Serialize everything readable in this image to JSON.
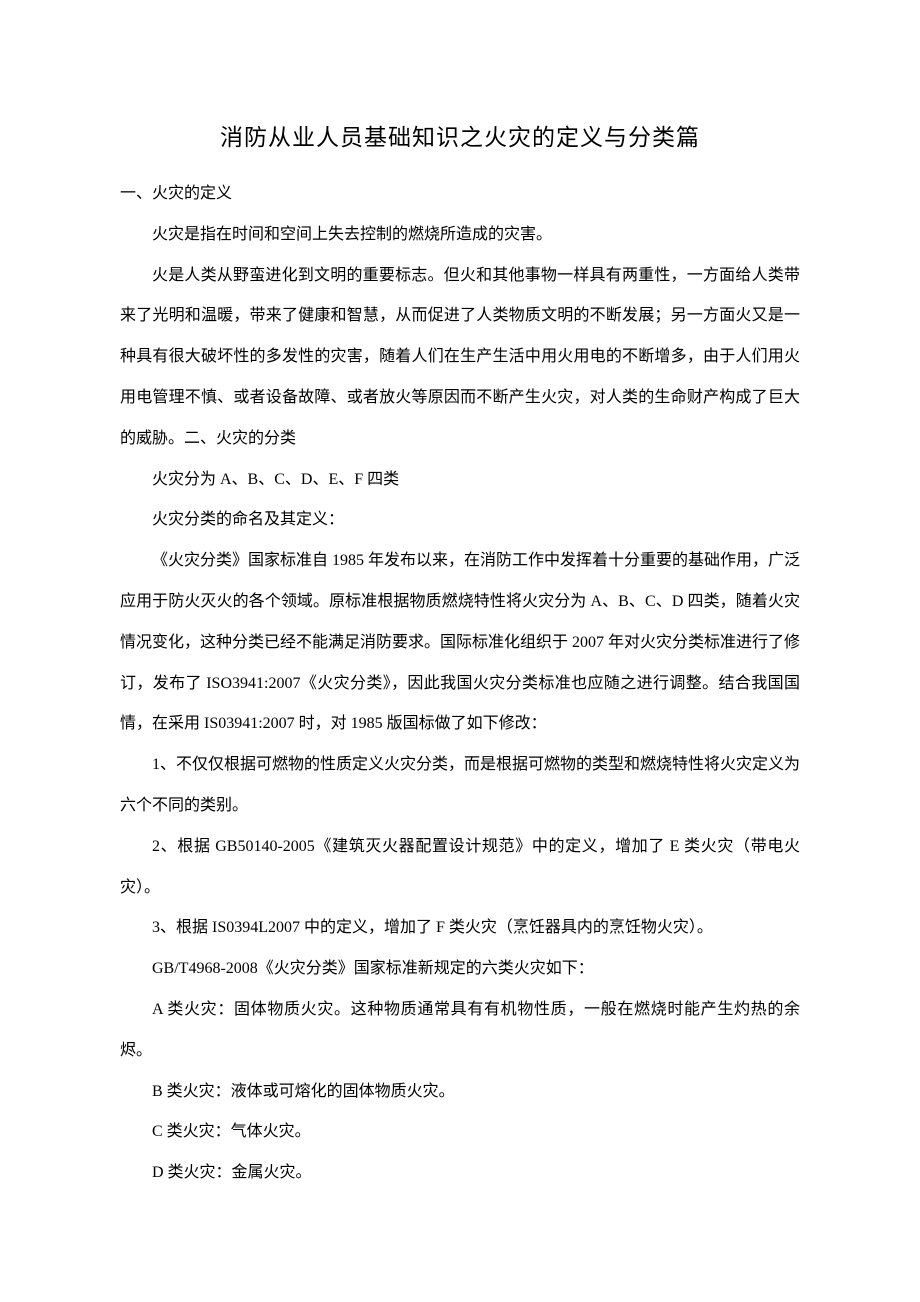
{
  "title": "消防从业人员基础知识之火灾的定义与分类篇",
  "s1_head": "一、火灾的定义",
  "p1": "火灾是指在时间和空间上失去控制的燃烧所造成的灾害。",
  "p2": "火是人类从野蛮进化到文明的重要标志。但火和其他事物一样具有两重性，一方面给人类带来了光明和温暖，带来了健康和智慧，从而促进了人类物质文明的不断发展；另一方面火又是一种具有很大破坏性的多发性的灾害，随着人们在生产生活中用火用电的不断增多，由于人们用火用电管理不慎、或者设备故障、或者放火等原因而不断产生火灾，对人类的生命财产构成了巨大的威胁。二、火灾的分类",
  "p3": "火灾分为 A、B、C、D、E、F 四类",
  "p4": "火灾分类的命名及其定义：",
  "p5": "《火灾分类》国家标准自 1985 年发布以来，在消防工作中发挥着十分重要的基础作用，广泛应用于防火灭火的各个领域。原标准根据物质燃烧特性将火灾分为 A、B、C、D 四类，随着火灾情况变化，这种分类已经不能满足消防要求。国际标准化组织于 2007 年对火灾分类标准进行了修订，发布了 ISO3941:2007《火灾分类》，因此我国火灾分类标准也应随之进行调整。结合我国国情，在采用 IS03941:2007 时，对 1985 版国标做了如下修改：",
  "p6": "1、不仅仅根据可燃物的性质定义火灾分类，而是根据可燃物的类型和燃烧特性将火灾定义为六个不同的类别。",
  "p7": "2、根据 GB50140-2005《建筑灭火器配置设计规范》中的定义，增加了 E 类火灾（带电火灾）。",
  "p8": "3、根据 IS0394L2007 中的定义，增加了 F 类火灾（烹饪器具内的烹饪物火灾）。",
  "p9": "GB/T4968-2008《火灾分类》国家标准新规定的六类火灾如下：",
  "p10": "A 类火灾：固体物质火灾。这种物质通常具有有机物性质，一般在燃烧时能产生灼热的余烬。",
  "p11": "B 类火灾：液体或可熔化的固体物质火灾。",
  "p12": "C 类火灾：气体火灾。",
  "p13": "D 类火灾：金属火灾。"
}
